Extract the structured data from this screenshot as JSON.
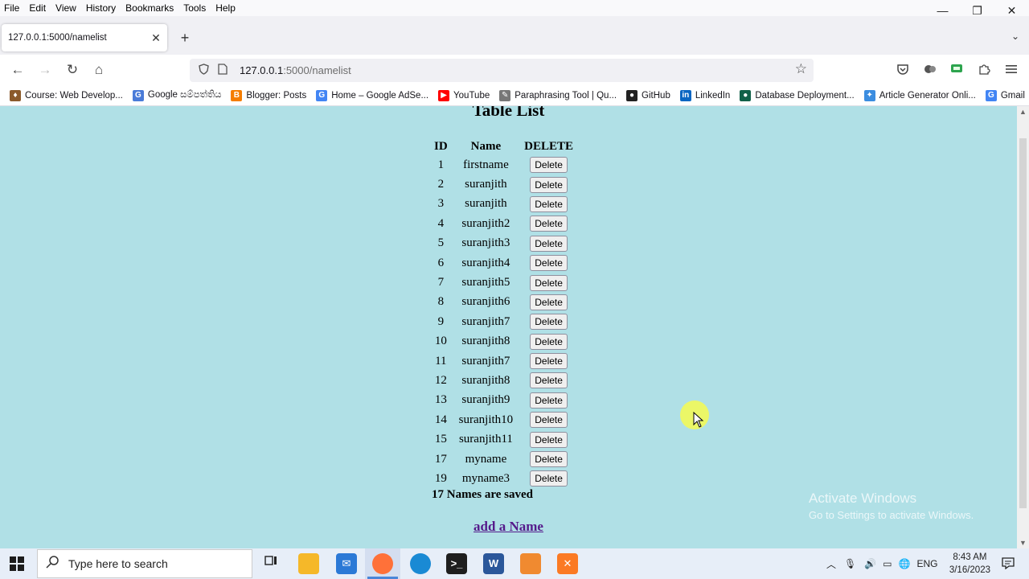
{
  "menu": [
    "File",
    "Edit",
    "View",
    "History",
    "Bookmarks",
    "Tools",
    "Help"
  ],
  "window_controls": {
    "minimize": "—",
    "restore": "❐",
    "close": "✕"
  },
  "tab": {
    "title": "127.0.0.1:5000/namelist",
    "close": "✕",
    "new_tab": "+",
    "list_all": "⌄"
  },
  "nav": {
    "back": "←",
    "forward": "→",
    "reload": "↻",
    "home": "⌂",
    "url_host": "127.0.0.1",
    "url_path": ":5000/namelist",
    "bookmark_star": "☆"
  },
  "bookmarks": [
    {
      "label": "Course: Web Develop...",
      "icon": "flame-icon",
      "color": "#8b5a2b",
      "glyph": "♦"
    },
    {
      "label": "Google සම්පත්තිය",
      "icon": "translate-icon",
      "color": "#4a7bd8",
      "glyph": "G"
    },
    {
      "label": "Blogger: Posts",
      "icon": "blogger-icon",
      "color": "#f57d00",
      "glyph": "B"
    },
    {
      "label": "Home – Google AdSe...",
      "icon": "google-icon",
      "color": "#4285f4",
      "glyph": "G"
    },
    {
      "label": "YouTube",
      "icon": "youtube-icon",
      "color": "#ff0000",
      "glyph": "▶"
    },
    {
      "label": "Paraphrasing Tool | Qu...",
      "icon": "quill-icon",
      "color": "#777777",
      "glyph": "✎"
    },
    {
      "label": "GitHub",
      "icon": "github-icon",
      "color": "#222222",
      "glyph": "●"
    },
    {
      "label": "LinkedIn",
      "icon": "linkedin-icon",
      "color": "#0a66c2",
      "glyph": "in"
    },
    {
      "label": "Database Deployment...",
      "icon": "mongodb-icon",
      "color": "#116149",
      "glyph": "●"
    },
    {
      "label": "Article Generator Onli...",
      "icon": "seo-icon",
      "color": "#3b8de0",
      "glyph": "✦"
    },
    {
      "label": "Gmail",
      "icon": "google-icon",
      "color": "#4285f4",
      "glyph": "G"
    }
  ],
  "page": {
    "title": "Table List",
    "headers": {
      "id": "ID",
      "name": "Name",
      "delete": "DELETE"
    },
    "rows": [
      {
        "id": "1",
        "name": "firstname",
        "action": "Delete"
      },
      {
        "id": "2",
        "name": "suranjith",
        "action": "Delete"
      },
      {
        "id": "3",
        "name": "suranjith",
        "action": "Delete"
      },
      {
        "id": "4",
        "name": "suranjith2",
        "action": "Delete"
      },
      {
        "id": "5",
        "name": "suranjith3",
        "action": "Delete"
      },
      {
        "id": "6",
        "name": "suranjith4",
        "action": "Delete"
      },
      {
        "id": "7",
        "name": "suranjith5",
        "action": "Delete"
      },
      {
        "id": "8",
        "name": "suranjith6",
        "action": "Delete"
      },
      {
        "id": "9",
        "name": "suranjith7",
        "action": "Delete"
      },
      {
        "id": "10",
        "name": "suranjith8",
        "action": "Delete"
      },
      {
        "id": "11",
        "name": "suranjith7",
        "action": "Delete"
      },
      {
        "id": "12",
        "name": "suranjith8",
        "action": "Delete"
      },
      {
        "id": "13",
        "name": "suranjith9",
        "action": "Delete"
      },
      {
        "id": "14",
        "name": "suranjith10",
        "action": "Delete"
      },
      {
        "id": "15",
        "name": "suranjith11",
        "action": "Delete"
      },
      {
        "id": "17",
        "name": "myname",
        "action": "Delete"
      },
      {
        "id": "19",
        "name": "myname3",
        "action": "Delete"
      }
    ],
    "saved_count": "17 Names are saved",
    "add_link": "add a Name",
    "background": "#b0e0e6"
  },
  "watermark": {
    "line1": "Activate Windows",
    "line2": "Go to Settings to activate Windows."
  },
  "taskbar": {
    "search_placeholder": "Type here to search",
    "language": "ENG",
    "time": "8:43 AM",
    "date": "3/16/2023"
  }
}
